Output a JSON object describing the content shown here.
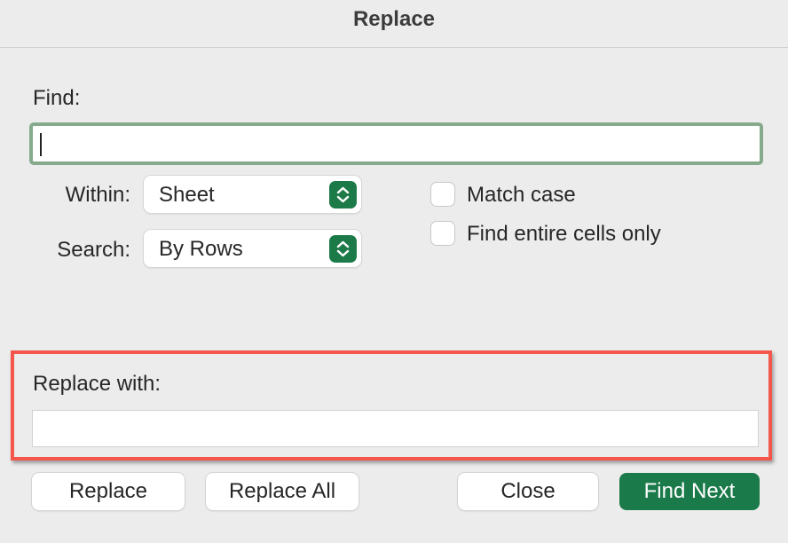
{
  "dialog": {
    "title": "Replace"
  },
  "find": {
    "label": "Find:",
    "value": ""
  },
  "within": {
    "label": "Within:",
    "value": "Sheet"
  },
  "search": {
    "label": "Search:",
    "value": "By Rows"
  },
  "options": {
    "match_case": {
      "label": "Match case",
      "checked": false
    },
    "entire_cells": {
      "label": "Find entire cells only",
      "checked": false
    }
  },
  "replace": {
    "label": "Replace with:",
    "value": ""
  },
  "buttons": {
    "replace": "Replace",
    "replace_all": "Replace All",
    "close": "Close",
    "find_next": "Find Next"
  },
  "colors": {
    "accent": "#1b7a4a",
    "highlight": "#f4564c",
    "focus_ring": "#86ab8c"
  }
}
